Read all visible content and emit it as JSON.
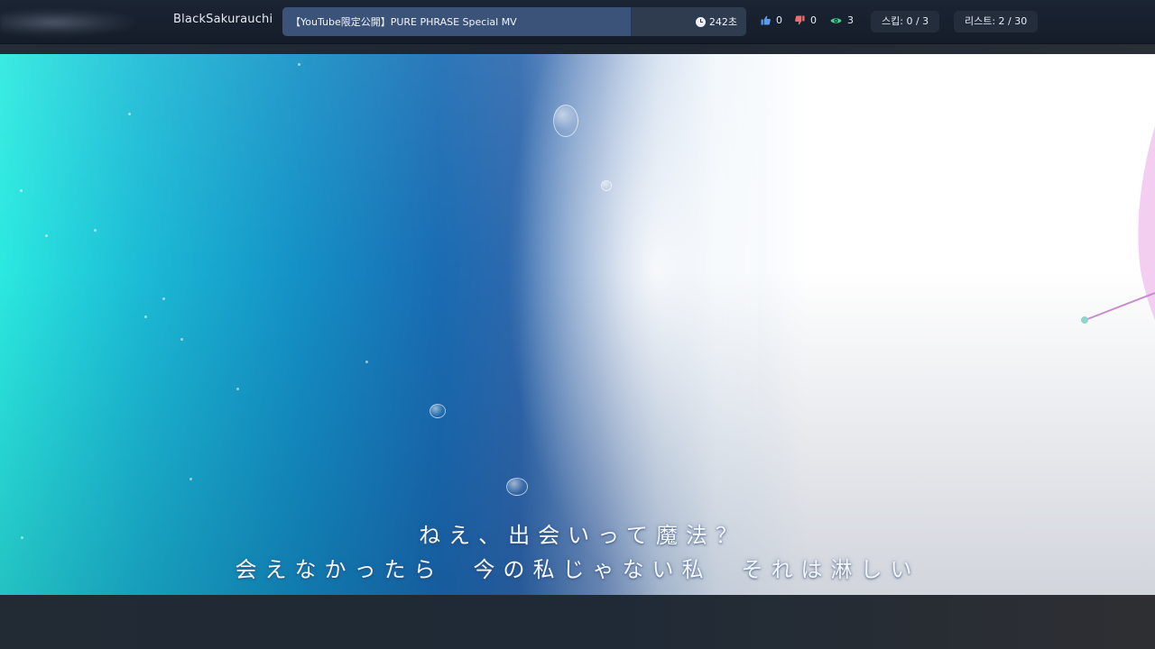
{
  "header": {
    "username": "BlackSakurauchi",
    "video_title": "【YouTube限定公開】PURE PHRASE Special MV",
    "duration": "242초",
    "likes": "0",
    "dislikes": "0",
    "views": "3",
    "skip": "스킵: 0 / 3",
    "playlist": "리스트: 2 / 30",
    "progress_fraction": 0.75
  },
  "video": {
    "lyric_line_1": "ねえ、出会いって魔法？",
    "lyric_line_2": "会えなかったら　今の私じゃない私　それは淋しい"
  },
  "colors": {
    "like": "#5b9bf2",
    "dislike": "#f06b6b",
    "views": "#3fd68f",
    "progress": "#3c5379"
  },
  "icons": {
    "logo": "blurred-logo",
    "duration": "clock-icon",
    "likes": "thumbs-up-icon",
    "dislikes": "thumbs-down-icon",
    "views": "eye-icon"
  }
}
